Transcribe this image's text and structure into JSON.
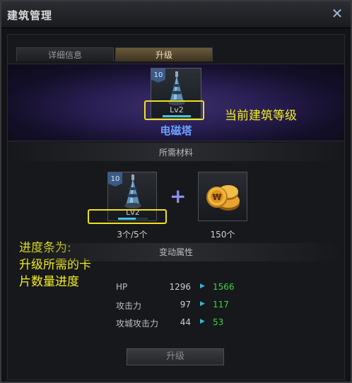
{
  "window": {
    "title": "建筑管理",
    "close_symbol": "✕"
  },
  "tabs": [
    {
      "label": "详细信息",
      "active": false
    },
    {
      "label": "升级",
      "active": true
    }
  ],
  "building": {
    "card_level": "10",
    "level_text": "Lv2",
    "name": "电磁塔"
  },
  "annotations": {
    "current_level": "当前建筑等级",
    "progress_line1": "进度条为:",
    "progress_line2": "升级所需的卡",
    "progress_line3": "片数量进度"
  },
  "materials": {
    "section_title": "所需材料",
    "card_item": {
      "level": "10",
      "level_text": "Lv2",
      "quantity": "3个/5个",
      "progress": 0.6
    },
    "plus_symbol": "+",
    "gold_item": {
      "quantity": "150个"
    }
  },
  "stats": {
    "section_title": "变动属性",
    "rows": [
      {
        "name": "HP",
        "old": "1296",
        "new": "1566"
      },
      {
        "name": "攻击力",
        "old": "97",
        "new": "117"
      },
      {
        "name": "攻城攻击力",
        "old": "44",
        "new": "53"
      }
    ],
    "arrow_symbol": "▶"
  },
  "upgrade_button": {
    "label": "升级"
  },
  "colors": {
    "highlight": "#f0e020",
    "annotation": "#f4f020",
    "name_blue": "#6aa0ff",
    "new_value_green": "#3fd24a"
  }
}
